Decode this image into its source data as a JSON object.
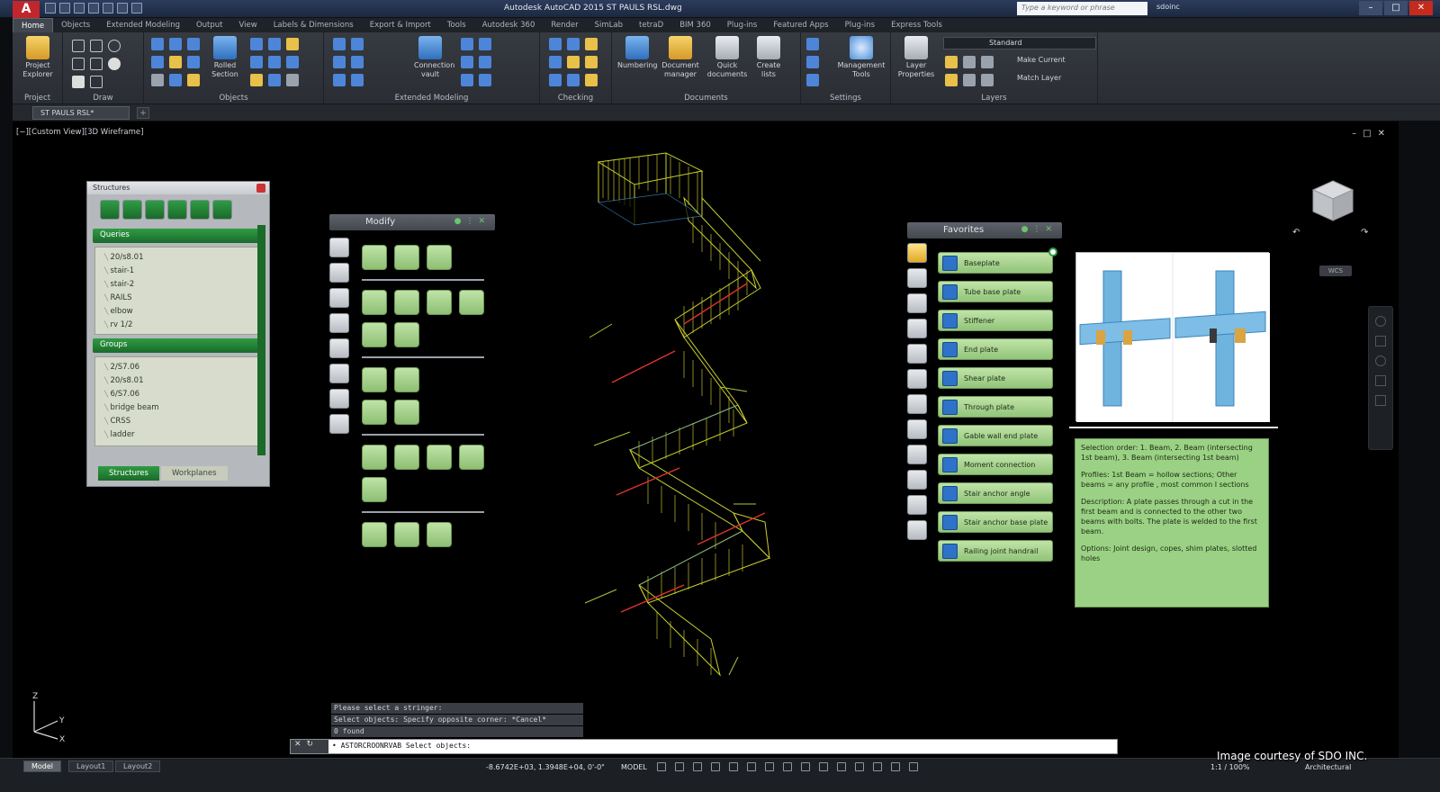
{
  "app": {
    "title": "Autodesk AutoCAD 2015   ST PAULS RSL.dwg",
    "search_placeholder": "Type a keyword or phrase",
    "user": "sdoinc",
    "logo_letter": "A"
  },
  "ribbon_tabs": [
    "Home",
    "Objects",
    "Extended Modeling",
    "Output",
    "View",
    "Labels & Dimensions",
    "Export & Import",
    "Tools",
    "Autodesk 360",
    "Render",
    "SimLab",
    "tetraD",
    "BIM 360",
    "Plug-ins",
    "Featured Apps",
    "Plug-ins",
    "Express Tools"
  ],
  "ribbon": {
    "panels": [
      "Project",
      "Draw",
      "Objects",
      "Extended Modeling",
      "Checking",
      "Documents",
      "Settings",
      "Layers"
    ],
    "buttons": {
      "project_explorer": "Project Explorer",
      "rolled_section": "Rolled Section",
      "connection_vault": "Connection vault",
      "numbering": "Numbering",
      "document_manager": "Document manager",
      "quick_documents": "Quick documents",
      "create_lists": "Create lists",
      "management_tools": "Management Tools",
      "layer_properties": "Layer Properties",
      "layer_state": "Standard",
      "make_current": "Make Current",
      "match_layer": "Match Layer"
    }
  },
  "doc_tab": "ST PAULS RSL*",
  "viewport": {
    "label": "[−][Custom View][3D Wireframe]",
    "wcs": "WCS"
  },
  "structures": {
    "title": "Structures",
    "queries_header": "Queries",
    "queries": [
      "20/s8.01",
      "stair-1",
      "stair-2",
      "RAILS",
      "elbow",
      "rv 1/2"
    ],
    "groups_header": "Groups",
    "groups": [
      "2/S7.06",
      "20/s8.01",
      "6/S7.06",
      "bridge beam",
      "CRSS",
      "ladder"
    ],
    "tabs": [
      "Structures",
      "Workplanes"
    ]
  },
  "modify": {
    "title": "Modify"
  },
  "favorites": {
    "title": "Favorites",
    "items": [
      "Baseplate",
      "Tube base plate",
      "Stiffener",
      "End plate",
      "Shear plate",
      "Through plate",
      "Gable wall end plate",
      "Moment connection",
      "Stair anchor angle",
      "Stair anchor base plate",
      "Railing joint handrail"
    ]
  },
  "description": {
    "selection": "Selection order: 1. Beam, 2. Beam (intersecting 1st beam), 3. Beam (intersecting 1st beam)",
    "profiles": "Profiles: 1st Beam = hollow sections; Other beams = any profile , most common I sections",
    "description": "Description: A plate passes through a cut in the first beam and is connected to the other two beams with bolts. The plate is welded to the first beam.",
    "options": "Options: Joint design, copes, shim plates, slotted holes"
  },
  "command": {
    "history": [
      "Please select a stringer:",
      "Select objects: Specify opposite corner: *Cancel*",
      "0 found"
    ],
    "prompt": "• ASTORCROONRVAB Select objects:"
  },
  "status": {
    "layout_tabs": [
      "Model",
      "Layout1",
      "Layout2"
    ],
    "coords": "-8.6742E+03, 1.3948E+04, 0'-0\"",
    "model": "MODEL",
    "scale": "1:1 / 100%",
    "workspace": "Architectural"
  },
  "credit": "Image courtesy of SDO INC.",
  "colors": {
    "accent_green": "#2f9c44",
    "palette_green": "#9bd184",
    "stair_yellow": "#c9cf2c",
    "rail_red": "#e0342c",
    "ribbon_dark": "#2a2d33"
  }
}
